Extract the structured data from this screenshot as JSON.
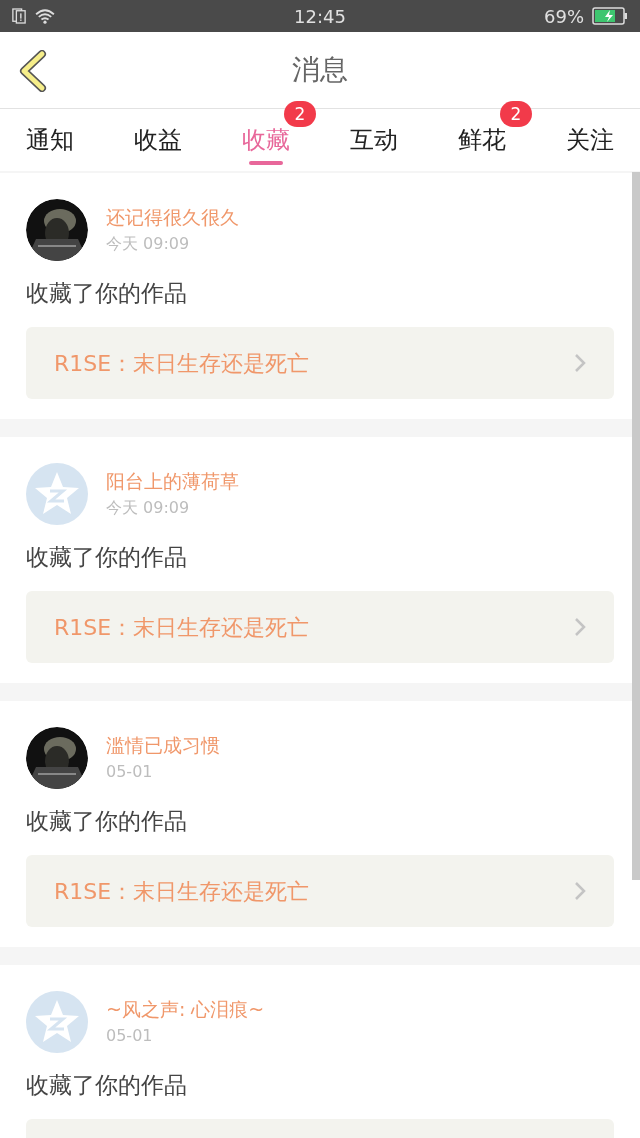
{
  "status_bar": {
    "time": "12:45",
    "battery": "69%"
  },
  "header": {
    "title": "消息"
  },
  "tabs": [
    {
      "label": "通知",
      "selected": false
    },
    {
      "label": "收益",
      "selected": false
    },
    {
      "label": "收藏",
      "selected": true,
      "badge": "2"
    },
    {
      "label": "互动",
      "selected": false
    },
    {
      "label": "鲜花",
      "selected": false,
      "badge": "2"
    },
    {
      "label": "关注",
      "selected": false
    }
  ],
  "messages": [
    {
      "user": "还记得很久很久",
      "time": "今天 09:09",
      "action": "收藏了你的作品",
      "work": "R1SE：末日生存还是死亡"
    },
    {
      "user": "阳台上的薄荷草",
      "avatar": {
        "kind": "default"
      },
      "time": "今天 09:09",
      "action": "收藏了你的作品",
      "work": "R1SE：末日生存还是死亡"
    },
    {
      "user": "滥情已成习惯",
      "time": "05-01",
      "action": "收藏了你的作品",
      "work": "R1SE：末日生存还是死亡"
    },
    {
      "user": "~风之声: 心泪痕~",
      "avatar": {
        "kind": "default"
      },
      "time": "05-01",
      "action": "收藏了你的作品"
    }
  ]
}
